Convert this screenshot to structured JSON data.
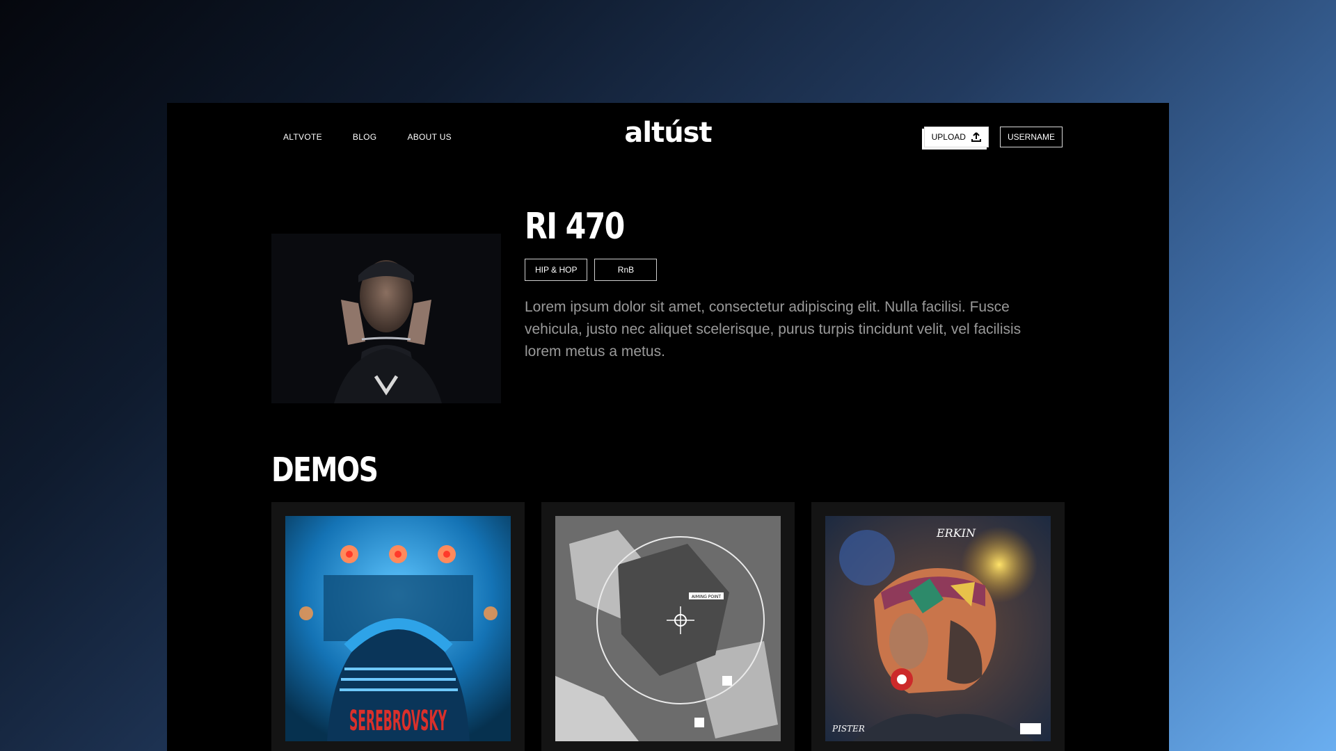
{
  "nav": {
    "links": [
      "ALTVOTE",
      "BLOG",
      "ABOUT US"
    ]
  },
  "logo": "altúst",
  "actions": {
    "upload_label": "UPLOAD",
    "upload_icon": "upload-icon",
    "username_label": "USERNAME"
  },
  "artist": {
    "name": "RI 470",
    "tags": [
      "HIP & HOP",
      "RnB"
    ],
    "bio": "Lorem ipsum dolor sit amet, consectetur adipiscing elit. Nulla facilisi. Fusce vehicula, justo nec aliquet scelerisque, purus turpis tincidunt velit, vel facilisis lorem metus a metus."
  },
  "demos": {
    "title": "DEMOS",
    "items": [
      {
        "cover_text": "SEREBROVSKY"
      },
      {
        "cover_text": "AIMING POINT"
      },
      {
        "cover_text_top": "ERKIN",
        "cover_text_bottom": "PISTER"
      }
    ]
  },
  "colors": {
    "background": "#000000",
    "card": "#141414",
    "bio_text": "#9a9a9a",
    "accent_red": "#d9302b",
    "accent_blue": "#1f8fd6"
  }
}
